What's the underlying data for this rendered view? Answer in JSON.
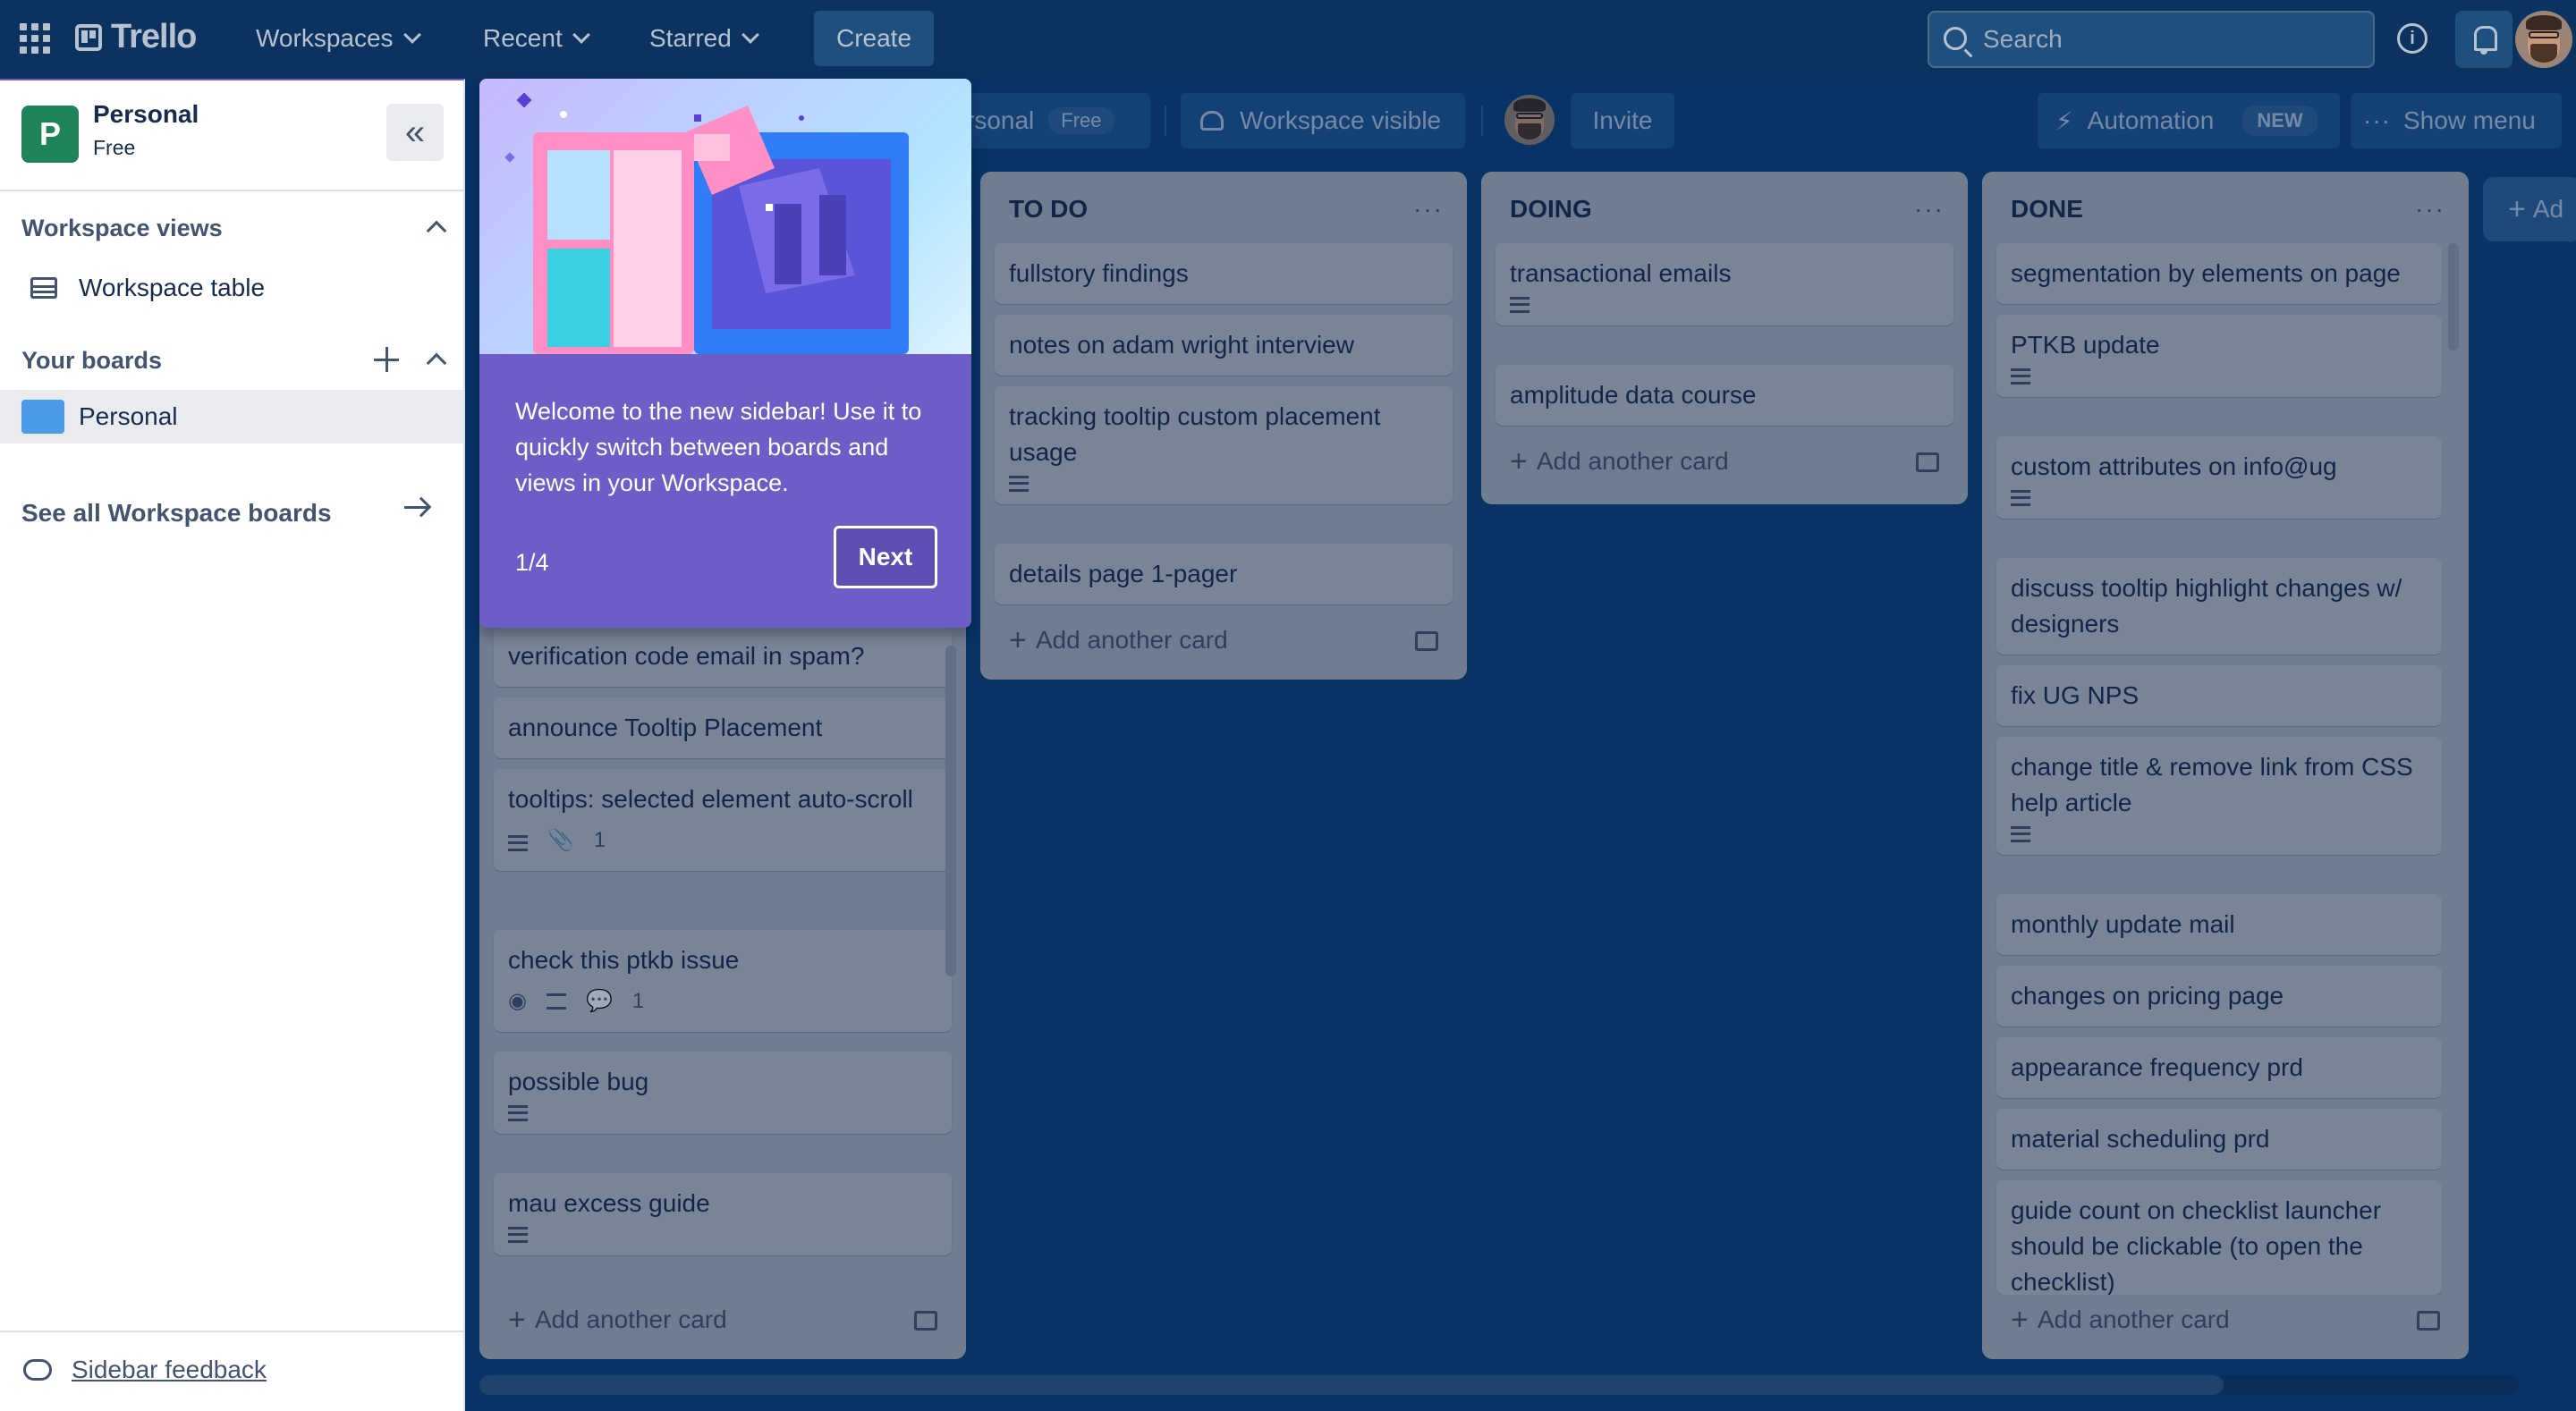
{
  "topnav": {
    "brand": "Trello",
    "workspaces": "Workspaces",
    "recent": "Recent",
    "starred": "Starred",
    "create": "Create",
    "search_placeholder": "Search"
  },
  "sidebar": {
    "workspace_initial": "P",
    "workspace_name": "Personal",
    "workspace_plan": "Free",
    "workspace_views_heading": "Workspace views",
    "workspace_table": "Workspace table",
    "your_boards_heading": "Your boards",
    "boards": [
      {
        "name": "Personal",
        "color": "#4c9be8"
      }
    ],
    "see_all": "See all Workspace boards",
    "feedback": "Sidebar feedback"
  },
  "boardbar": {
    "board_name_partial": "rsonal",
    "plan": "Free",
    "visibility": "Workspace visible",
    "invite": "Invite",
    "automation": "Automation",
    "automation_badge": "NEW",
    "show_menu": "Show menu",
    "add_list_partial": "Ad"
  },
  "popover": {
    "text": "Welcome to the new sidebar! Use it to quickly switch between boards and views in your Workspace.",
    "counter": "1/4",
    "next": "Next"
  },
  "lists": {
    "first": {
      "cards": [
        {
          "title": "verification code email in spam?"
        },
        {
          "title": "announce Tooltip Placement"
        },
        {
          "title": "tooltips: selected element auto-scroll",
          "attachments": "1"
        },
        {
          "title": "check this ptkb issue",
          "comments": "1"
        },
        {
          "title": "possible bug"
        },
        {
          "title": "mau excess guide"
        }
      ],
      "add_card": "Add another card"
    },
    "todo": {
      "title": "TO DO",
      "cards": [
        {
          "title": "fullstory findings"
        },
        {
          "title": "notes on adam wright interview"
        },
        {
          "title": "tracking tooltip custom placement usage"
        },
        {
          "title": "details page 1-pager"
        }
      ],
      "add_card": "Add another card"
    },
    "doing": {
      "title": "DOING",
      "cards": [
        {
          "title": "transactional emails"
        },
        {
          "title": "amplitude data course"
        }
      ],
      "add_card": "Add another card"
    },
    "done": {
      "title": "DONE",
      "cards": [
        {
          "title": "segmentation by elements on page"
        },
        {
          "title": "PTKB update"
        },
        {
          "title": "custom attributes on info@ug"
        },
        {
          "title": "discuss tooltip highlight changes w/ designers"
        },
        {
          "title": "fix UG NPS"
        },
        {
          "title": "change title & remove link from CSS help article"
        },
        {
          "title": "monthly update mail"
        },
        {
          "title": "changes on pricing page"
        },
        {
          "title": "appearance frequency prd"
        },
        {
          "title": "material scheduling prd"
        },
        {
          "title": "guide count on checklist launcher should be clickable (to open the checklist)"
        }
      ],
      "add_card": "Add another card"
    }
  },
  "colors": {
    "topnav": "#0c3360",
    "board_bg": "#08427f",
    "workspace_icon": "#1f845a",
    "popover": "#6e5dc6"
  }
}
